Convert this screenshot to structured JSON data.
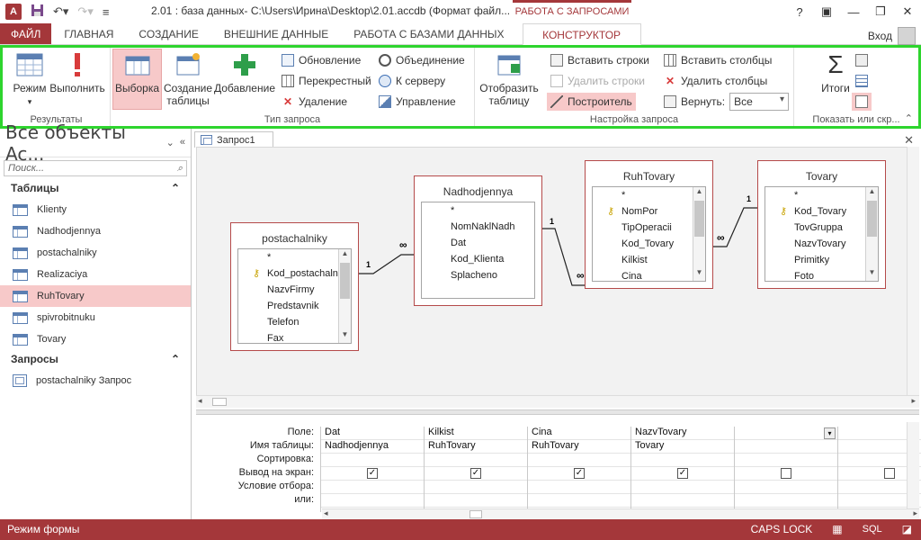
{
  "titlebar": {
    "app_icon": "A",
    "title": "2.01 : база данных- C:\\Users\\Ирина\\Desktop\\2.01.accdb (Формат файл...",
    "context_tab_group": "РАБОТА С ЗАПРОСАМИ",
    "help": "?",
    "minimize": "—",
    "restore": "❐",
    "close": "✕"
  },
  "tabs": [
    "ФАЙЛ",
    "ГЛАВНАЯ",
    "СОЗДАНИЕ",
    "ВНЕШНИЕ ДАННЫЕ",
    "РАБОТА С БАЗАМИ ДАННЫХ",
    "КОНСТРУКТОР"
  ],
  "signin": "Вход",
  "ribbon": {
    "results": {
      "label": "Результаты",
      "view": "Режим",
      "run": "Выполнить"
    },
    "query_type": {
      "label": "Тип запроса",
      "select": "Выборка",
      "make_table": "Создание таблицы",
      "append": "Добавление",
      "update": "Обновление",
      "crosstab": "Перекрестный",
      "delete": "Удаление",
      "union": "Объединение",
      "pass_through": "К серверу",
      "data_definition": "Управление"
    },
    "setup": {
      "label": "Настройка запроса",
      "show_table": "Отобразить таблицу",
      "insert_rows": "Вставить строки",
      "delete_rows": "Удалить строки",
      "builder": "Построитель",
      "insert_columns": "Вставить столбцы",
      "delete_columns": "Удалить столбцы",
      "return_label": "Вернуть:",
      "return_value": "Все"
    },
    "show_hide": {
      "label": "Показать или скр...",
      "totals": "Итоги"
    }
  },
  "nav": {
    "title": "Все объекты Ac...",
    "search_placeholder": "Поиск...",
    "tables_header": "Таблицы",
    "tables": [
      "Klienty",
      "Nadhodjennya",
      "postachalniky",
      "Realizaciya",
      "RuhTovary",
      "spivrobitnuku",
      "Tovary"
    ],
    "selected_table": "RuhTovary",
    "queries_header": "Запросы",
    "queries": [
      "postachalniky Запрос"
    ]
  },
  "document": {
    "tab_title": "Запрос1"
  },
  "field_lists": [
    {
      "name": "postachalniky",
      "fields": [
        {
          "n": "*",
          "k": false
        },
        {
          "n": "Kod_postachalnyka",
          "k": true
        },
        {
          "n": "NazvFirmy",
          "k": false
        },
        {
          "n": "Predstavnik",
          "k": false
        },
        {
          "n": "Telefon",
          "k": false
        },
        {
          "n": "Fax",
          "k": false
        }
      ]
    },
    {
      "name": "Nadhodjennya",
      "fields": [
        {
          "n": "*",
          "k": false
        },
        {
          "n": "NomNaklNadh",
          "k": false
        },
        {
          "n": "Dat",
          "k": false
        },
        {
          "n": "Kod_Klienta",
          "k": false
        },
        {
          "n": "Splacheno",
          "k": false
        }
      ]
    },
    {
      "name": "RuhTovary",
      "fields": [
        {
          "n": "*",
          "k": false
        },
        {
          "n": "NomPor",
          "k": true
        },
        {
          "n": "TipOperacii",
          "k": false
        },
        {
          "n": "Kod_Tovary",
          "k": false
        },
        {
          "n": "Kilkist",
          "k": false
        },
        {
          "n": "Cina",
          "k": false
        }
      ]
    },
    {
      "name": "Tovary",
      "fields": [
        {
          "n": "*",
          "k": false
        },
        {
          "n": "Kod_Tovary",
          "k": true
        },
        {
          "n": "TovGruppa",
          "k": false
        },
        {
          "n": "NazvTovary",
          "k": false
        },
        {
          "n": "Primitky",
          "k": false
        },
        {
          "n": "Foto",
          "k": false
        }
      ]
    }
  ],
  "relationships": {
    "one": "1",
    "many": "∞"
  },
  "grid": {
    "row_labels": [
      "Поле:",
      "Имя таблицы:",
      "Сортировка:",
      "Вывод на экран:",
      "Условие отбора:",
      "или:"
    ],
    "columns": [
      {
        "field": "Dat",
        "table": "Nadhodjennya",
        "show": true
      },
      {
        "field": "Kilkist",
        "table": "RuhTovary",
        "show": true
      },
      {
        "field": "Cina",
        "table": "RuhTovary",
        "show": true
      },
      {
        "field": "NazvTovary",
        "table": "Tovary",
        "show": true
      },
      {
        "field": "",
        "table": "",
        "show": false
      },
      {
        "field": "",
        "table": "",
        "show": false
      }
    ]
  },
  "status": {
    "left": "Режим формы",
    "caps": "CAPS LOCK",
    "sql": "SQL"
  },
  "colors": {
    "accent": "#a4373a",
    "ribbon_highlight": "#2ed52e",
    "selected": "#f7c9c9"
  }
}
